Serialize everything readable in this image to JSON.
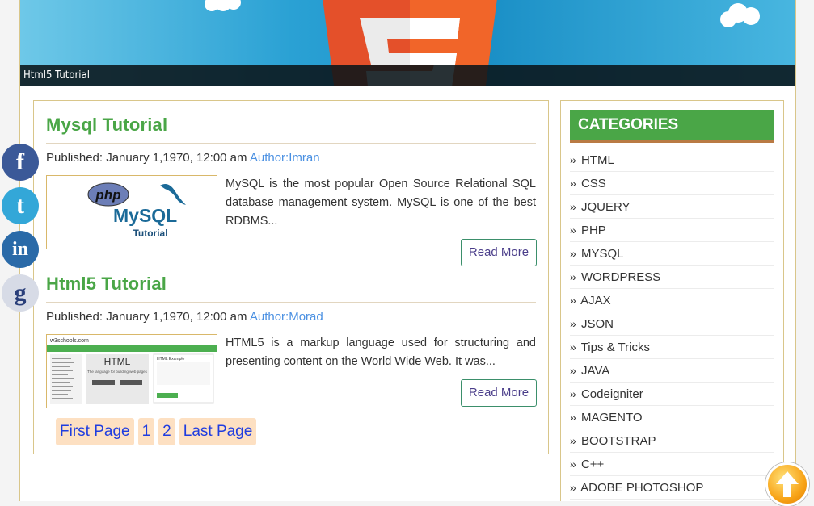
{
  "banner": {
    "title": "Html5 Tutorial"
  },
  "posts": [
    {
      "title": "Mysql Tutorial",
      "published": "Published: January 1,1970, 12:00 am",
      "author": "Author:Imran",
      "excerpt": "MySQL is the most popular Open Source Relational SQL database management system. MySQL is one of the best RDBMS...",
      "read_more": "Read More",
      "thumb": {
        "logo1": "php",
        "logo2": "MySQL",
        "caption": "Tutorial"
      }
    },
    {
      "title": "Html5 Tutorial",
      "published": "Published: January 1,1970, 12:00 am",
      "author": "Author:Morad",
      "excerpt": "HTML5 is a markup language used for structuring and presenting content on the World Wide Web. It was...",
      "read_more": "Read More",
      "thumb": {
        "site": "w3schools.com",
        "heading": "HTML",
        "sub": "The language for building web pages",
        "side": "HTML Example"
      }
    }
  ],
  "pager": {
    "first": "First Page",
    "p1": "1",
    "p2": "2",
    "last": "Last Page"
  },
  "sidebar": {
    "heading": "CATEGORIES",
    "items": [
      "HTML",
      "CSS",
      "JQUERY",
      "PHP",
      "MYSQL",
      "WORDPRESS",
      "AJAX",
      "JSON",
      "Tips & Tricks",
      "JAVA",
      "Codeigniter",
      "MAGENTO",
      "BOOTSTRAP",
      "C++",
      "ADOBE PHOTOSHOP"
    ]
  },
  "social": [
    {
      "icon": "facebook-icon",
      "glyph": "f",
      "color": "#3b5998"
    },
    {
      "icon": "twitter-icon",
      "glyph": "t",
      "color": "#33a7d8"
    },
    {
      "icon": "linkedin-icon",
      "glyph": "in",
      "color": "#2a6aa8"
    },
    {
      "icon": "google-icon",
      "glyph": "g",
      "color": "#2a3f7a"
    }
  ],
  "colors": {
    "accent_green": "#4aa647",
    "link_blue": "#4a90e2",
    "border_gold": "#d9c68a"
  }
}
